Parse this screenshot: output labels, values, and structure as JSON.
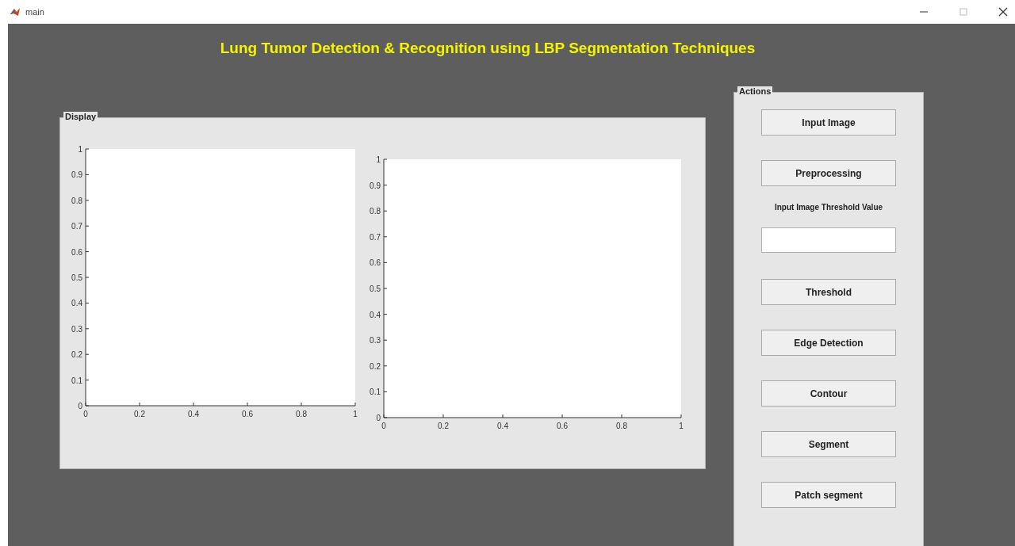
{
  "window": {
    "title": "main"
  },
  "heading": "Lung Tumor Detection & Recognition using LBP Segmentation Techniques",
  "display_panel": {
    "label": "Display",
    "axes": [
      {
        "chart_data": {
          "type": "line",
          "xlim": [
            0,
            1
          ],
          "ylim": [
            0,
            1
          ],
          "xticks": [
            0,
            0.2,
            0.4,
            0.6,
            0.8,
            1
          ],
          "yticks": [
            0,
            0.1,
            0.2,
            0.3,
            0.4,
            0.5,
            0.6,
            0.7,
            0.8,
            0.9,
            1
          ]
        }
      },
      {
        "chart_data": {
          "type": "line",
          "xlim": [
            0,
            1
          ],
          "ylim": [
            0,
            1
          ],
          "xticks": [
            0,
            0.2,
            0.4,
            0.6,
            0.8,
            1
          ],
          "yticks": [
            0,
            0.1,
            0.2,
            0.3,
            0.4,
            0.5,
            0.6,
            0.7,
            0.8,
            0.9,
            1
          ]
        }
      }
    ]
  },
  "actions_panel": {
    "label": "Actions",
    "items": [
      {
        "kind": "button",
        "label": "Input Image"
      },
      {
        "kind": "button",
        "label": "Preprocessing"
      },
      {
        "kind": "label",
        "label": "Input Image Threshold Value"
      },
      {
        "kind": "field"
      },
      {
        "kind": "button",
        "label": "Threshold"
      },
      {
        "kind": "button",
        "label": "Edge Detection"
      },
      {
        "kind": "button",
        "label": "Contour"
      },
      {
        "kind": "button",
        "label": "Segment"
      },
      {
        "kind": "button",
        "label": "Patch segment"
      }
    ]
  }
}
